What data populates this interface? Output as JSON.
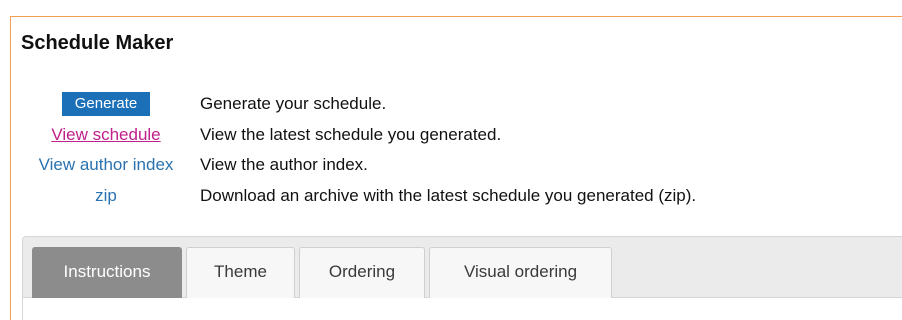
{
  "page": {
    "title": "Schedule Maker"
  },
  "actions": [
    {
      "label": "Generate",
      "description": "Generate your schedule."
    },
    {
      "label": "View schedule",
      "description": "View the latest schedule you generated."
    },
    {
      "label": "View author index",
      "description": "View the author index."
    },
    {
      "label": "zip",
      "description": "Download an archive with the latest schedule you generated (zip)."
    }
  ],
  "tabs": [
    {
      "label": "Instructions",
      "active": true
    },
    {
      "label": "Theme",
      "active": false
    },
    {
      "label": "Ordering",
      "active": false
    },
    {
      "label": "Visual ordering",
      "active": false
    }
  ],
  "colors": {
    "accent_border": "#f0a050",
    "button_blue": "#1b70b8",
    "link_blue": "#2a73b0",
    "link_visited": "#c0208a",
    "active_tab": "#8c8c8c"
  }
}
